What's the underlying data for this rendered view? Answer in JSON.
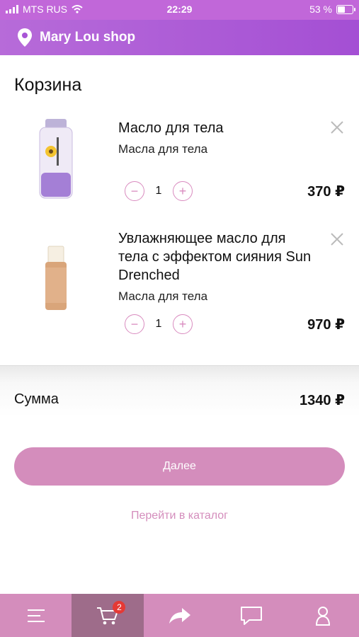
{
  "status": {
    "carrier": "MTS RUS",
    "time": "22:29",
    "battery": "53 %"
  },
  "header": {
    "shop_name": "Mary Lou shop"
  },
  "page": {
    "title": "Корзина"
  },
  "cart": {
    "items": [
      {
        "name": "Масло для тела",
        "category": "Масла для тела",
        "quantity": "1",
        "price": "370 ₽"
      },
      {
        "name": "Увлажняющее масло для тела с эффектом сияния Sun Drenched",
        "category": "Масла для тела",
        "quantity": "1",
        "price": "970 ₽"
      }
    ]
  },
  "summary": {
    "label": "Сумма",
    "total": "1340 ₽"
  },
  "actions": {
    "next_label": "Далее",
    "catalog_label": "Перейти в каталог"
  },
  "tabbar": {
    "cart_badge": "2",
    "items": [
      {
        "icon": "menu-icon"
      },
      {
        "icon": "cart-icon",
        "active": true
      },
      {
        "icon": "share-icon"
      },
      {
        "icon": "chat-icon"
      },
      {
        "icon": "profile-icon"
      }
    ]
  },
  "colors": {
    "header": "#a44fd4",
    "accent": "#d48dbc",
    "active_tab": "#9e6c8a",
    "badge": "#e53935"
  }
}
